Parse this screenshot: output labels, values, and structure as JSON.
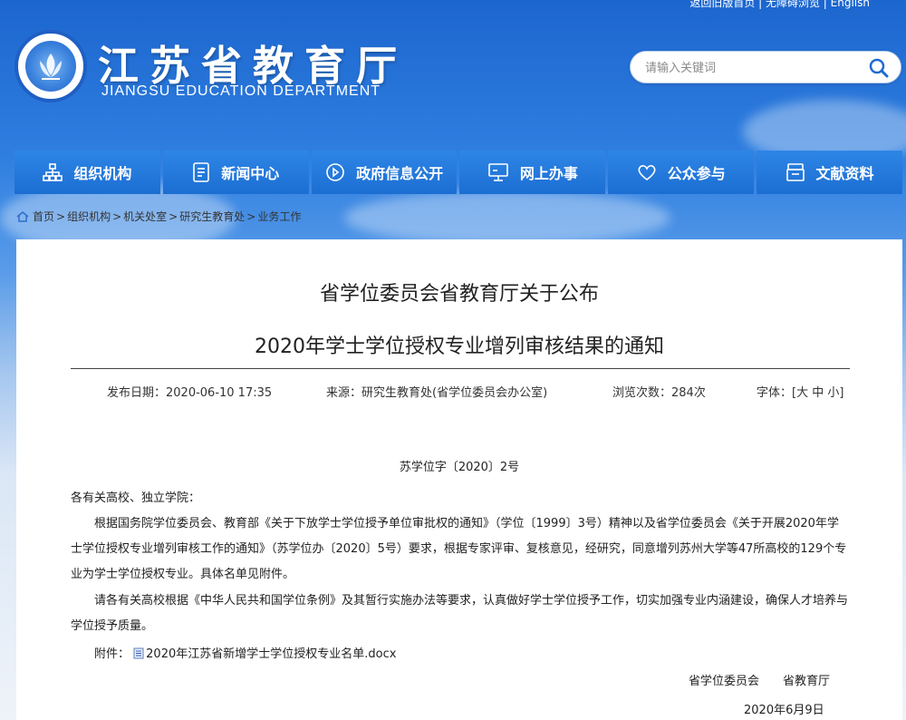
{
  "header": {
    "top_links": "返回旧版首页 | 无障碍浏览 | English",
    "site_name_cn": "江苏省教育厅",
    "site_name_en": "JIANGSU EDUCATION DEPARTMENT",
    "search_placeholder": "请输入关键词"
  },
  "nav": [
    {
      "label": "组织机构",
      "icon": "org-chart-icon"
    },
    {
      "label": "新闻中心",
      "icon": "news-document-icon"
    },
    {
      "label": "政府信息公开",
      "icon": "government-info-icon"
    },
    {
      "label": "网上办事",
      "icon": "monitor-icon"
    },
    {
      "label": "公众参与",
      "icon": "heart-icon"
    },
    {
      "label": "文献资料",
      "icon": "archive-icon"
    }
  ],
  "breadcrumb": [
    "首页",
    "组织机构",
    "机关处室",
    "研究生教育处",
    "业务工作"
  ],
  "article": {
    "title_line1": "省学位委员会省教育厅关于公布",
    "title_line2": "2020年学士学位授权专业增列审核结果的通知",
    "publish_date": "发布日期：2020-06-10 17:35",
    "source": "来源：研究生教育处(省学位委员会办公室)",
    "views": "浏览次数：284次",
    "font_size": "字体：[大 中 小]",
    "doc_number": "苏学位字〔2020〕2号",
    "salutation": "各有关高校、独立学院：",
    "paragraph1": "根据国务院学位委员会、教育部《关于下放学士学位授予单位审批权的通知》（学位〔1999〕3号）精神以及省学位委员会《关于开展2020年学士学位授权专业增列审核工作的通知》（苏学位办〔2020〕5号）要求，根据专家评审、复核意见，经研究，同意增列苏州大学等47所高校的129个专业为学士学位授权专业。具体名单见附件。",
    "paragraph2": "请各有关高校根据《中华人民共和国学位条例》及其暂行实施办法等要求，认真做好学士学位授予工作，切实加强专业内涵建设，确保人才培养与学位授予质量。",
    "attachment_label": "附件：",
    "attachment_file": "2020年江苏省新增学士学位授权专业名单.docx",
    "signer1": "省学位委员会",
    "signer2": "省教育厅",
    "sign_date": "2020年6月9日"
  },
  "colors": {
    "nav_bg": "#1c6ed2",
    "header_bg": "#2f7fe0",
    "text": "#222222"
  }
}
